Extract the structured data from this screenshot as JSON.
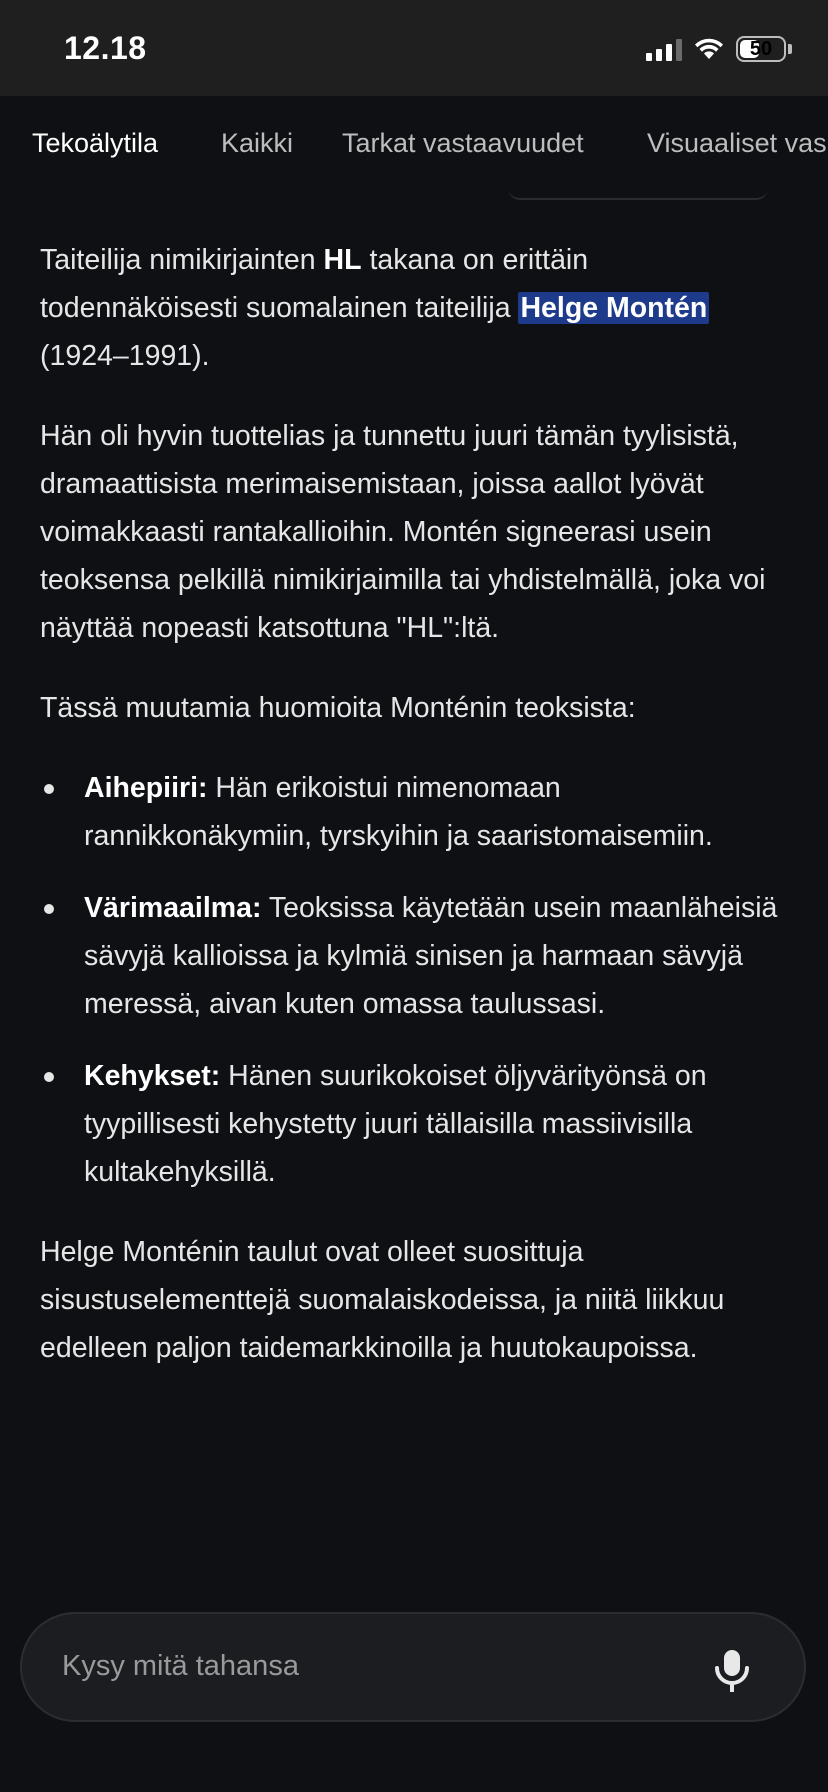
{
  "status": {
    "time": "12.18",
    "battery": "50",
    "battery_level": 0.5
  },
  "tabs": [
    {
      "label": "Tekoälytila",
      "active": true
    },
    {
      "label": "Kaikki",
      "active": false
    },
    {
      "label": "Tarkat vastaavuudet",
      "active": false
    },
    {
      "label": "Visuaaliset vas",
      "active": false
    }
  ],
  "content": {
    "p1": {
      "a": "Taiteilija nimikirjainten ",
      "b": "HL",
      "c": " takana on erittäin todennäköisesti suomalainen taiteilija ",
      "highlight": "Helge Montén",
      "d": " (1924–1991)."
    },
    "p2": "Hän oli hyvin tuottelias ja tunnettu juuri tämän tyylisistä, dramaattisista merimaisemistaan, joissa aallot lyövät voimakkaasti rantakallioihin. Montén signeerasi usein teoksensa pelkillä nimikirjaimilla tai yhdistelmällä, joka voi näyttää nopeasti katsottuna \"HL\":ltä.",
    "p3": "Tässä muutamia huomioita Monténin teoksista:",
    "bullets": [
      {
        "title": "Aihepiiri:",
        "text": " Hän erikoistui nimenomaan rannikkonäkymiin, tyrskyihin ja saaristomaisemiin."
      },
      {
        "title": "Värimaailma:",
        "text": " Teoksissa käytetään usein maanläheisiä sävyjä kallioissa ja kylmiä sinisen ja harmaan sävyjä meressä, aivan kuten omassa taulussasi."
      },
      {
        "title": "Kehykset:",
        "text": " Hänen suurikokoiset öljyvärityönsä on tyypillisesti kehystetty juuri tällaisilla massiivisilla kultakehyksillä."
      }
    ],
    "p4": "Helge Monténin taulut ovat olleet suosittuja sisustuselementtejä suomalaiskodeissa, ja niitä liikkuu edelleen paljon taidemarkkinoilla ja huutokaupoissa."
  },
  "input": {
    "placeholder": "Kysy mitä tahansa",
    "mic_icon": "microphone-icon"
  }
}
